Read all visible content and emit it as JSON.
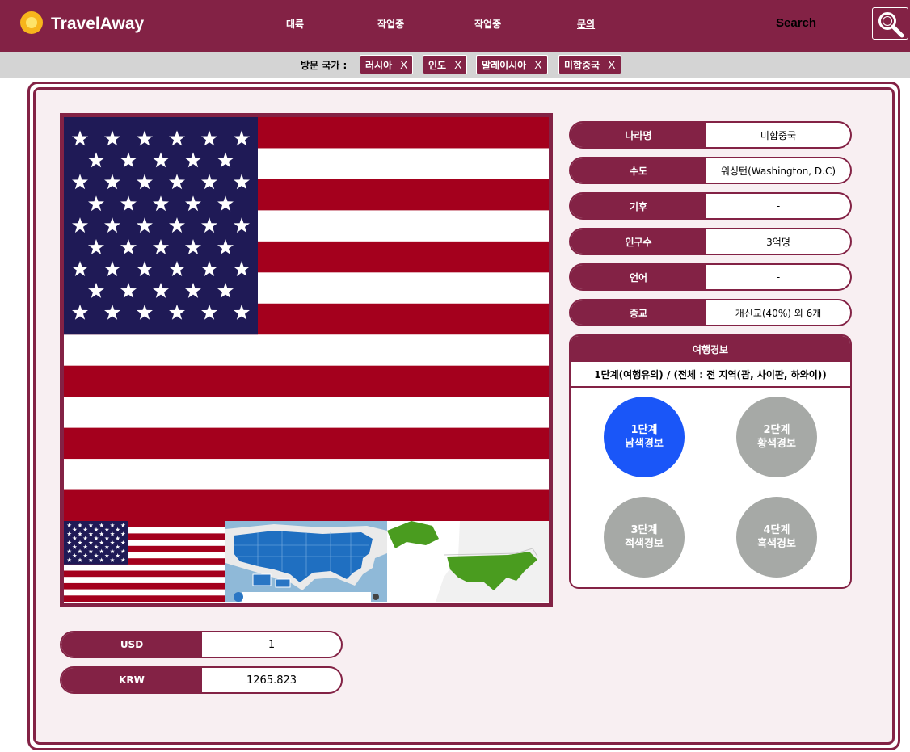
{
  "header": {
    "logo_text": "TravelAway",
    "nav": [
      "대륙",
      "작업중",
      "작업중",
      "문의"
    ],
    "search_label": "Search"
  },
  "visit": {
    "label": "방문 국가 :",
    "chips": [
      {
        "name": "러시아",
        "close": "X"
      },
      {
        "name": "인도",
        "close": "X"
      },
      {
        "name": "말레이시아",
        "close": "X"
      },
      {
        "name": "미합중국",
        "close": "X"
      }
    ]
  },
  "info": [
    {
      "label": "나라명",
      "value": "미합중국"
    },
    {
      "label": "수도",
      "value": "워싱턴(Washington, D.C)"
    },
    {
      "label": "기후",
      "value": "-"
    },
    {
      "label": "인구수",
      "value": "3억명"
    },
    {
      "label": "언어",
      "value": "-"
    },
    {
      "label": "종교",
      "value": "개신교(40%) 외 6개"
    }
  ],
  "warning": {
    "title": "여행경보",
    "subtitle": "1단계(여행유의) / (전체 : 전 지역(괌, 사이판, 하와이))",
    "levels": [
      {
        "line1": "1단계",
        "line2": "남색경보",
        "color": "#1a56f8",
        "active": true
      },
      {
        "line1": "2단계",
        "line2": "황색경보",
        "color": "#a6a9a6",
        "active": false
      },
      {
        "line1": "3단계",
        "line2": "적색경보",
        "color": "#a6a9a6",
        "active": false
      },
      {
        "line1": "4단계",
        "line2": "흑색경보",
        "color": "#a6a9a6",
        "active": false
      }
    ]
  },
  "currency": [
    {
      "code": "USD",
      "value": "1"
    },
    {
      "code": "KRW",
      "value": "1265.823"
    }
  ],
  "colors": {
    "brand": "#832245",
    "panel_bg": "#f8eff2",
    "flag_red": "#a4001d",
    "flag_blue": "#1f1a56"
  },
  "icons": {
    "logo": "sun-logo-icon",
    "search": "magnifier-icon"
  }
}
